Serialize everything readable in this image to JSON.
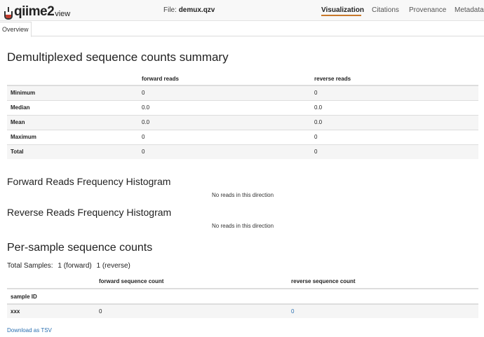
{
  "header": {
    "logo_text": "qiime2",
    "logo_suffix": "view",
    "file_prefix": "File:",
    "file_name": "demux.qzv",
    "nav": [
      "Visualization",
      "Citations",
      "Provenance",
      "Metadata"
    ]
  },
  "tabs": {
    "overview": "Overview"
  },
  "summary": {
    "title": "Demultiplexed sequence counts summary",
    "columns": [
      "forward reads",
      "reverse reads"
    ],
    "rows": [
      {
        "label": "Minimum",
        "forward": "0",
        "reverse": "0"
      },
      {
        "label": "Median",
        "forward": "0.0",
        "reverse": "0.0"
      },
      {
        "label": "Mean",
        "forward": "0.0",
        "reverse": "0.0"
      },
      {
        "label": "Maximum",
        "forward": "0",
        "reverse": "0"
      },
      {
        "label": "Total",
        "forward": "0",
        "reverse": "0"
      }
    ]
  },
  "forward_hist": {
    "title": "Forward Reads Frequency Histogram",
    "message": "No reads in this direction"
  },
  "reverse_hist": {
    "title": "Reverse Reads Frequency Histogram",
    "message": "No reads in this direction"
  },
  "per_sample": {
    "title": "Per-sample sequence counts",
    "total_label": "Total Samples:",
    "total_forward": "1 (forward)",
    "total_reverse": "1 (reverse)",
    "columns": [
      "forward sequence count",
      "reverse sequence count"
    ],
    "id_header": "sample ID",
    "rows": [
      {
        "id": "xxx",
        "forward": "0",
        "reverse": "0"
      }
    ]
  },
  "download_label": "Download as TSV",
  "colors": {
    "accent": "#c8782a",
    "link": "#2a6fb0",
    "logo_fill": "#c0392b"
  }
}
